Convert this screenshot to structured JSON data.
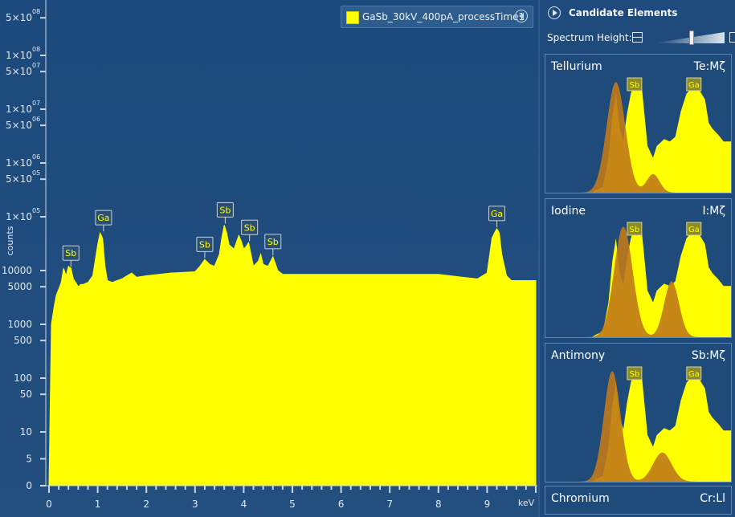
{
  "legend": {
    "label": "GaSb_30kV_400pA_processTime1",
    "swatch_color": "#ffff00",
    "collapse_icon": "chevron-left-icon"
  },
  "chart_data": {
    "type": "area",
    "title": "",
    "xlabel": "keV",
    "ylabel": "counts",
    "xlim": [
      0,
      10
    ],
    "ylim": [
      0,
      500000000
    ],
    "y_scale": "log",
    "grid": false,
    "legend_position": "top-right",
    "x_ticks": [
      "0",
      "1",
      "2",
      "3",
      "4",
      "5",
      "6",
      "7",
      "8",
      "9"
    ],
    "y_tick_labels": [
      {
        "text": "5×10",
        "exp": "08"
      },
      {
        "text": "1×10",
        "exp": "08"
      },
      {
        "text": "5×10",
        "exp": "07"
      },
      {
        "text": "1×10",
        "exp": "07"
      },
      {
        "text": "5×10",
        "exp": "06"
      },
      {
        "text": "1×10",
        "exp": "06"
      },
      {
        "text": "5×10",
        "exp": "05"
      },
      {
        "text": "1×10",
        "exp": "05"
      },
      {
        "text": "10000",
        "exp": ""
      },
      {
        "text": "5000",
        "exp": ""
      },
      {
        "text": "1000",
        "exp": ""
      },
      {
        "text": "500",
        "exp": ""
      },
      {
        "text": "100",
        "exp": ""
      },
      {
        "text": "50",
        "exp": ""
      },
      {
        "text": "10",
        "exp": ""
      },
      {
        "text": "5",
        "exp": ""
      },
      {
        "text": "0",
        "exp": ""
      }
    ],
    "y_tick_values": [
      500000000,
      100000000,
      50000000,
      10000000,
      5000000,
      1000000,
      500000,
      100000,
      10000,
      5000,
      1000,
      500,
      100,
      50,
      10,
      5,
      0
    ],
    "series": [
      {
        "color": "#ffff00",
        "x": [
          0,
          0.05,
          0.1,
          0.15,
          0.2,
          0.25,
          0.3,
          0.35,
          0.4,
          0.45,
          0.5,
          0.55,
          0.6,
          0.65,
          0.7,
          0.8,
          0.9,
          1.0,
          1.05,
          1.1,
          1.15,
          1.2,
          1.3,
          1.4,
          1.5,
          1.6,
          1.7,
          1.8,
          2.0,
          2.5,
          3.0,
          3.1,
          3.2,
          3.3,
          3.4,
          3.5,
          3.55,
          3.6,
          3.65,
          3.7,
          3.8,
          3.9,
          3.95,
          4.0,
          4.05,
          4.1,
          4.15,
          4.2,
          4.3,
          4.35,
          4.4,
          4.5,
          4.6,
          4.7,
          4.8,
          5.0,
          6.0,
          7.0,
          8.0,
          8.5,
          8.8,
          9.0,
          9.1,
          9.15,
          9.2,
          9.25,
          9.3,
          9.4,
          9.5,
          10.0
        ],
        "y": [
          0,
          1000,
          2000,
          3500,
          4500,
          6000,
          11000,
          8000,
          12000,
          11000,
          7000,
          6000,
          5000,
          5500,
          5500,
          6000,
          8000,
          30000,
          50000,
          40000,
          12000,
          6500,
          6000,
          6500,
          7000,
          8000,
          9000,
          7500,
          8000,
          9000,
          9500,
          12000,
          16000,
          13000,
          12000,
          20000,
          40000,
          70000,
          50000,
          30000,
          25000,
          45000,
          35000,
          25000,
          28000,
          33000,
          20000,
          12000,
          15000,
          20000,
          13000,
          12000,
          18000,
          10000,
          8500,
          8500,
          8500,
          8500,
          8500,
          7500,
          7000,
          9000,
          40000,
          50000,
          60000,
          50000,
          20000,
          8000,
          6500,
          6500
        ]
      }
    ],
    "annotations": [
      {
        "label": "Sb",
        "x": 0.45,
        "y": 11000
      },
      {
        "label": "Ga",
        "x": 1.12,
        "y": 50000
      },
      {
        "label": "Sb",
        "x": 3.2,
        "y": 16000
      },
      {
        "label": "Sb",
        "x": 3.62,
        "y": 70000
      },
      {
        "label": "Sb",
        "x": 4.12,
        "y": 33000
      },
      {
        "label": "Sb",
        "x": 4.6,
        "y": 18000
      },
      {
        "label": "Ga",
        "x": 9.2,
        "y": 60000
      }
    ]
  },
  "sidebar": {
    "title": "Candidate Elements",
    "play_icon": "play-circle-icon",
    "height_label": "Spectrum Height:",
    "height_level": 0.55,
    "candidates": [
      {
        "name": "Tellurium",
        "code": "Te:Mζ",
        "overlay_peaks": [
          {
            "pos": 0.38,
            "h": 0.95,
            "w": 0.05
          },
          {
            "pos": 0.58,
            "h": 0.16,
            "w": 0.035
          }
        ]
      },
      {
        "name": "Iodine",
        "code": "I:Mζ",
        "overlay_peaks": [
          {
            "pos": 0.42,
            "h": 0.95,
            "w": 0.05
          },
          {
            "pos": 0.68,
            "h": 0.48,
            "w": 0.04
          }
        ]
      },
      {
        "name": "Antimony",
        "code": "Sb:Mζ",
        "overlay_peaks": [
          {
            "pos": 0.36,
            "h": 0.95,
            "w": 0.045
          },
          {
            "pos": 0.63,
            "h": 0.25,
            "w": 0.05
          }
        ]
      },
      {
        "name": "Chromium",
        "code": "Cr:Ll"
      }
    ],
    "mini_labels": [
      "Sb",
      "Ga"
    ]
  }
}
